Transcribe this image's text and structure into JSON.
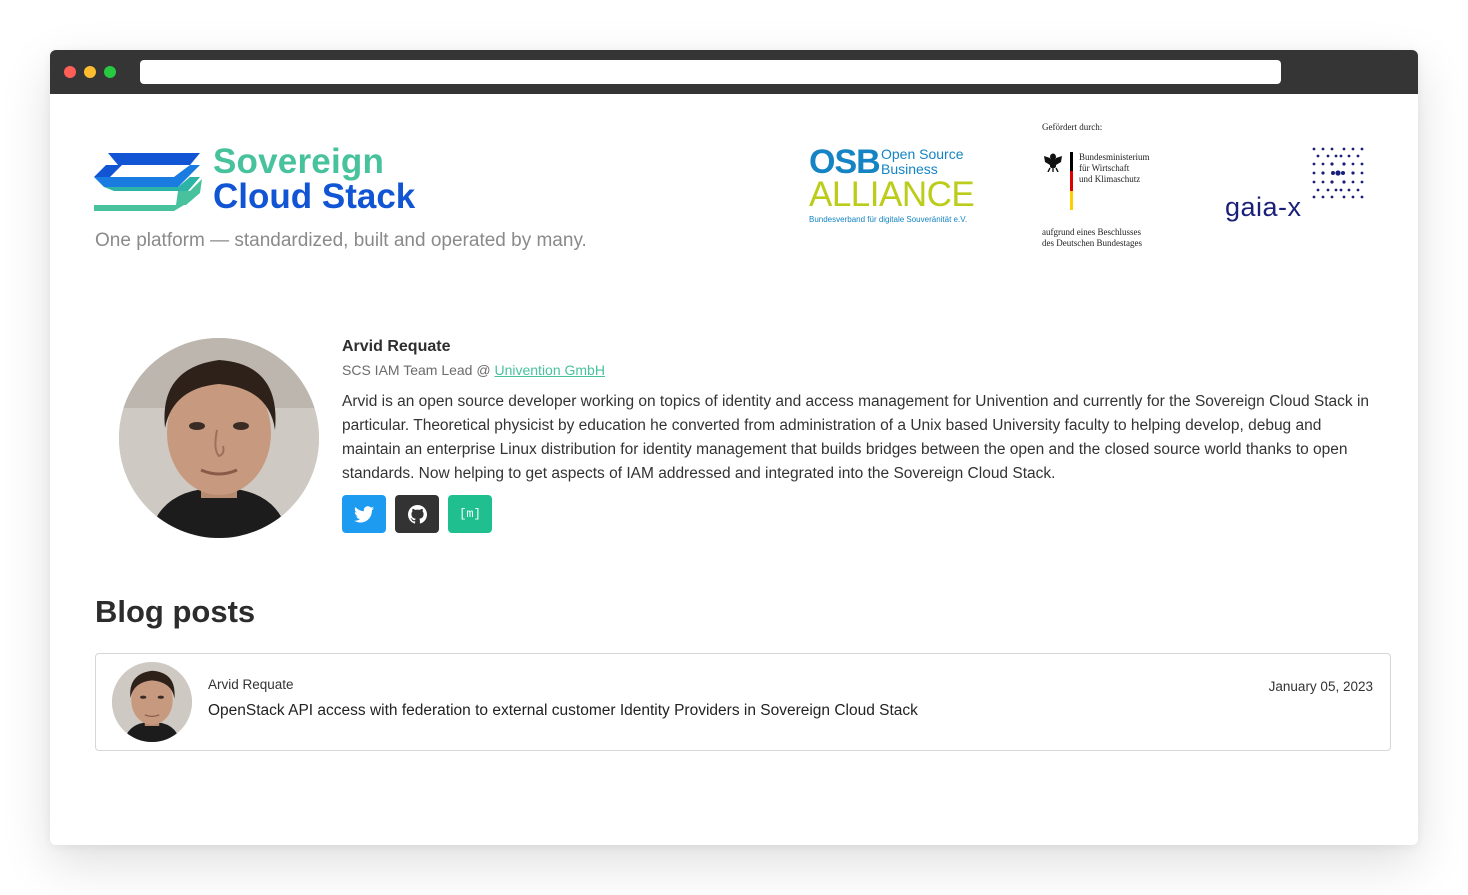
{
  "header": {
    "logo_line1": "Sovereign",
    "logo_line2": "Cloud Stack",
    "tagline": "One platform — standardized, built and operated by many.",
    "osb": {
      "big": "OSB",
      "small_line1": "Open Source",
      "small_line2": "Business",
      "alliance": "ALLIANCE",
      "tagline": "Bundesverband für digitale Souveränität e.V."
    },
    "funding": {
      "top": "Gefördert durch:",
      "ministry_line1": "Bundesministerium",
      "ministry_line2": "für Wirtschaft",
      "ministry_line3": "und Klimaschutz",
      "bottom_line1": "aufgrund eines Beschlusses",
      "bottom_line2": "des Deutschen Bundestages"
    },
    "gaia": "gaia-x"
  },
  "profile": {
    "name": "Arvid Requate",
    "role_prefix": "SCS IAM Team Lead @ ",
    "company": "Univention GmbH",
    "bio": "Arvid is an open source developer working on topics of identity and access management for Univention and currently for the Sovereign Cloud Stack in particular. Theoretical physicist by education he converted from administration of a Unix based University faculty to helping develop, debug and maintain an enterprise Linux distribution for identity management that builds bridges between the open and the closed source world thanks to open standards. Now helping to get aspects of IAM addressed and integrated into the Sovereign Cloud Stack.",
    "socials": [
      {
        "name": "twitter",
        "icon": "twitter-icon",
        "color": "#1d9bf0"
      },
      {
        "name": "github",
        "icon": "github-icon",
        "color": "#333333"
      },
      {
        "name": "matrix",
        "icon": "matrix-icon",
        "color": "#1fbf8f",
        "glyph": "[m]"
      }
    ]
  },
  "blog": {
    "heading": "Blog posts",
    "posts": [
      {
        "author": "Arvid Requate",
        "title": "OpenStack API access with federation to external customer Identity Providers in Sovereign Cloud Stack",
        "date": "January 05, 2023"
      }
    ]
  },
  "colors": {
    "brand_green": "#48c29c",
    "brand_blue": "#1155d4",
    "osb_blue": "#1484c4",
    "osb_lime": "#bccc1a",
    "gaia_navy": "#1a1f7a"
  }
}
